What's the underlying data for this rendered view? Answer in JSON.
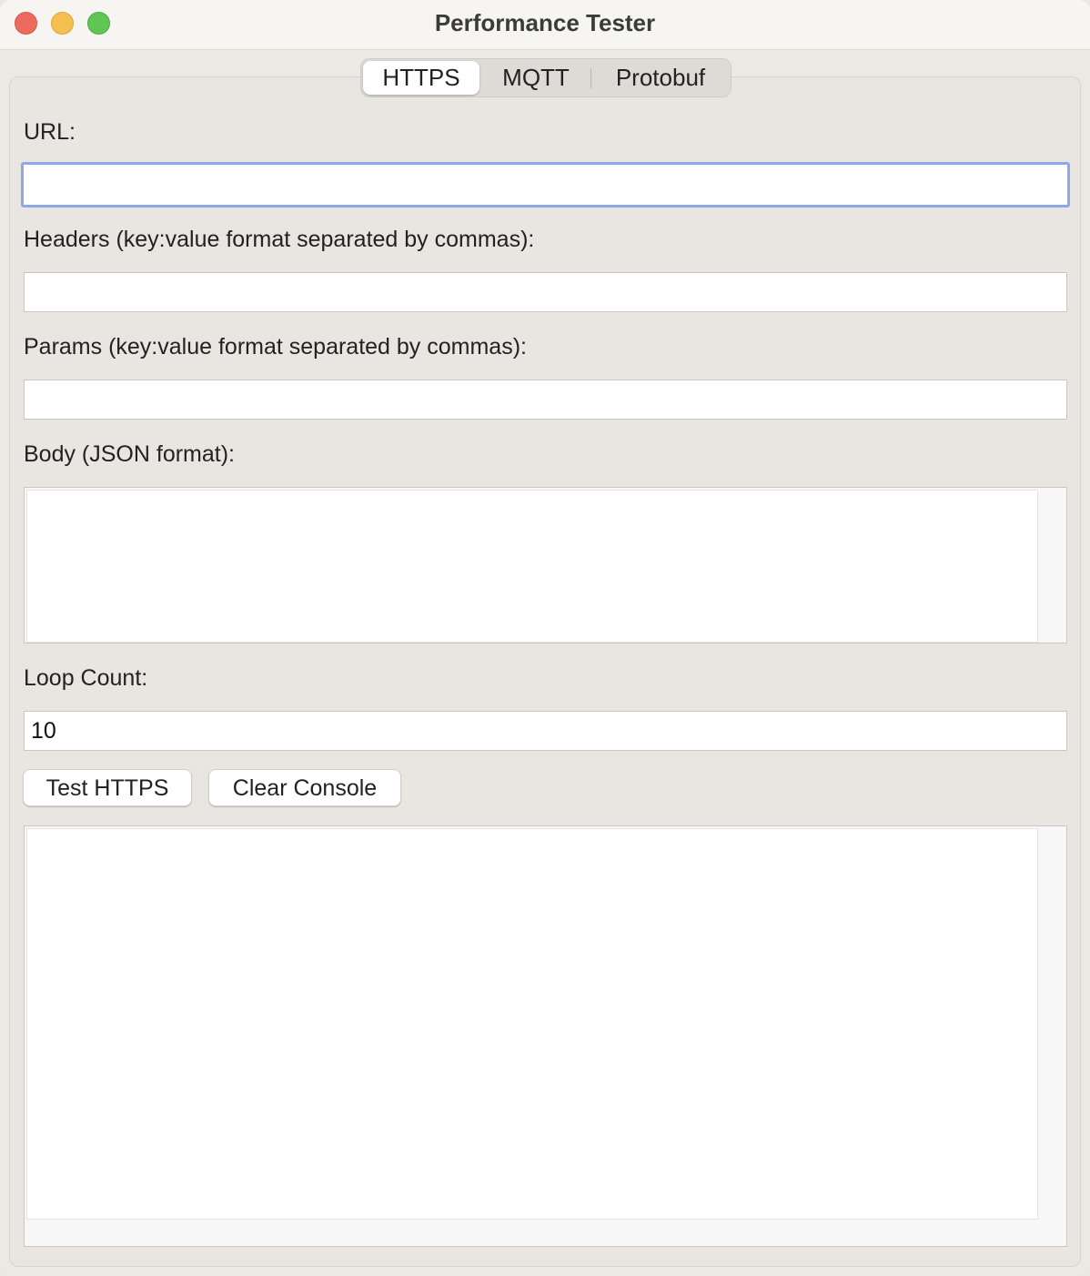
{
  "window": {
    "title": "Performance Tester"
  },
  "tabs": [
    {
      "label": "HTTPS",
      "active": true
    },
    {
      "label": "MQTT",
      "active": false
    },
    {
      "label": "Protobuf",
      "active": false
    }
  ],
  "form": {
    "url_label": "URL:",
    "url_value": "",
    "headers_label": "Headers (key:value format separated by commas):",
    "headers_value": "",
    "params_label": "Params (key:value format separated by commas):",
    "params_value": "",
    "body_label": "Body (JSON format):",
    "loop_label": "Loop Count:",
    "loop_value": "10"
  },
  "buttons": {
    "test_label": "Test HTTPS",
    "clear_label": "Clear Console"
  },
  "colors": {
    "focus_ring": "#8aa8ea",
    "close": "#ed6a5e",
    "minimize": "#f5bf4f",
    "maximize": "#61c554"
  }
}
